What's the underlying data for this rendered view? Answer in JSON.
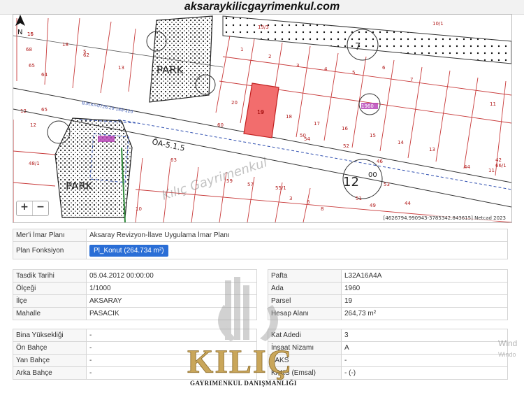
{
  "header": {
    "site_url": "aksaraykilicgayrimenkul.com"
  },
  "map": {
    "labels": {
      "park_a": "PARK",
      "park_b": "PARK",
      "block_7": "7",
      "block_12": "12",
      "block_00": "00",
      "road_code": "ÖA-5.1.5",
      "bmk": "B.M.K=0726.20-188-120",
      "mini_block": "1960",
      "parcel_19": "19",
      "watermark": "Kılıç Gayrimenkul"
    },
    "parcel_numbers": [
      "16",
      "68",
      "65",
      "64",
      "62",
      "13",
      "18",
      "12",
      "5",
      "19/3",
      "1",
      "2",
      "3",
      "4",
      "5",
      "6",
      "7",
      "10/1",
      "65",
      "12",
      "11",
      "60",
      "20",
      "19",
      "18",
      "17",
      "16",
      "15",
      "14",
      "13",
      "44",
      "42",
      "50",
      "52",
      "54",
      "63",
      "59",
      "57",
      "55/1",
      "3",
      "6",
      "8",
      "44",
      "49",
      "51",
      "53",
      "46",
      "48/1",
      "66/1",
      "11",
      "10",
      "15"
    ],
    "attribution": "[4626794.990943-3785342.843615] Netcad 2023",
    "north_label": "N",
    "zoom_in": "+",
    "zoom_out": "−",
    "highlight_color": "#f26d6d"
  },
  "plan": {
    "rows": [
      {
        "label": "Mer'i İmar Planı",
        "value": "Aksaray Revizyon-İlave Uygulama İmar Planı"
      },
      {
        "label": "Plan Fonksiyon",
        "value": "Pl_Konut (264.734 m²)"
      }
    ]
  },
  "details_left": [
    {
      "label": "Tasdik Tarihi",
      "value": "05.04.2012 00:00:00"
    },
    {
      "label": "Ölçeği",
      "value": "1/1000"
    },
    {
      "label": "İlçe",
      "value": "AKSARAY"
    },
    {
      "label": "Mahalle",
      "value": "PASACIK"
    }
  ],
  "details_right": [
    {
      "label": "Pafta",
      "value": "L32A16A4A"
    },
    {
      "label": "Ada",
      "value": "1960"
    },
    {
      "label": "Parsel",
      "value": "19"
    },
    {
      "label": "Hesap Alanı",
      "value": "264,73 m²"
    }
  ],
  "building_left": [
    {
      "label": "Bina Yüksekliği",
      "value": "-"
    },
    {
      "label": "Ön Bahçe",
      "value": "-"
    },
    {
      "label": "Yan Bahçe",
      "value": "-"
    },
    {
      "label": "Arka Bahçe",
      "value": "-"
    }
  ],
  "building_right": [
    {
      "label": "Kat Adedi",
      "value": "3"
    },
    {
      "label": "İnşaat Nizamı",
      "value": "A"
    },
    {
      "label": "TAKS",
      "value": "-"
    },
    {
      "label": "KAKS (Emsal)",
      "value": "- (-)"
    }
  ],
  "logo": {
    "name": "KILIÇ",
    "subtitle": "GAYRIMENKUL DANIŞMANLIĞI"
  },
  "windows_watermark": {
    "line1": "Wind",
    "line2": "Windo"
  }
}
